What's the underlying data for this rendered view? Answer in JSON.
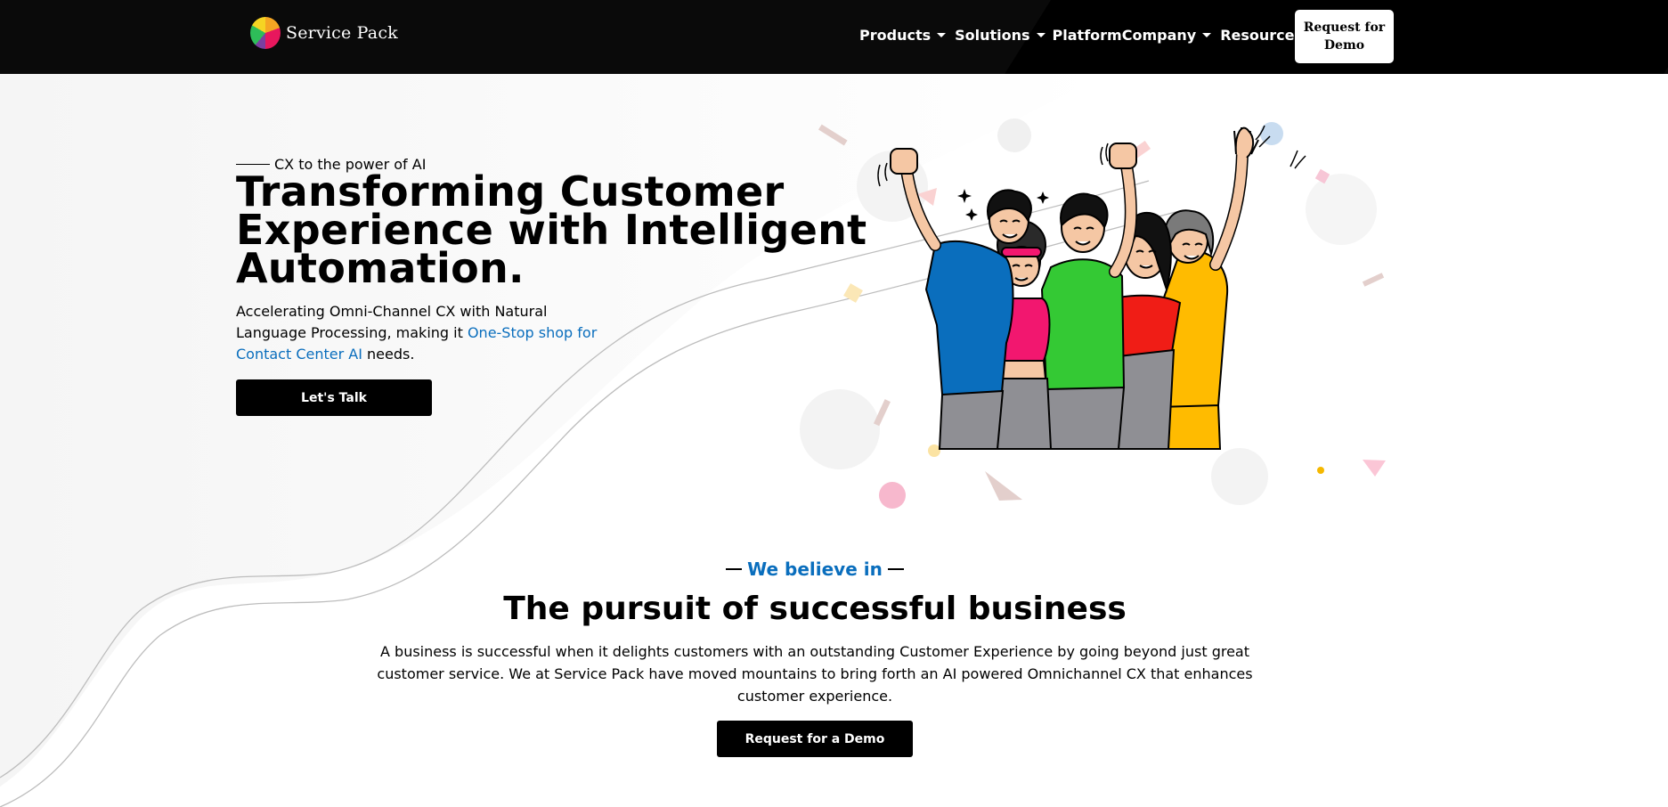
{
  "header": {
    "brand_name": "Service Pack",
    "nav": [
      {
        "label": "Products",
        "has_dropdown": true
      },
      {
        "label": "Solutions",
        "has_dropdown": true
      },
      {
        "label": "Platform",
        "has_dropdown": false
      },
      {
        "label": "Company",
        "has_dropdown": true
      },
      {
        "label": "Resources",
        "has_dropdown": true
      }
    ],
    "cta_label": "Request for Demo"
  },
  "hero": {
    "eyebrow": "CX to the power of AI",
    "title": "Transforming Customer Experience with Intelligent Automation.",
    "subtitle_pre": "Accelerating Omni-Channel CX with Natural Language Processing, making it ",
    "subtitle_link": "One-Stop shop for Contact Center AI",
    "subtitle_post": " needs.",
    "button_label": "Let's Talk"
  },
  "about": {
    "eyebrow": "We believe in",
    "title": "The pursuit of successful business",
    "body": "A business is successful when it delights customers with an outstanding Customer Experience by going beyond just great customer service. We at Service Pack have moved mountains to bring forth an AI powered Omnichannel CX that enhances customer experience.",
    "button_label": "Request for a Demo"
  },
  "colors": {
    "header_bg": "#0a0a0a",
    "accent_blue": "#0a6ebd",
    "shirt_blue": "#0a6ebd",
    "shirt_pink": "#f2176f",
    "shirt_green": "#34c934",
    "shirt_red": "#f01d16",
    "shirt_yellow": "#ffbb00",
    "pants_grey": "#8f8f94"
  }
}
